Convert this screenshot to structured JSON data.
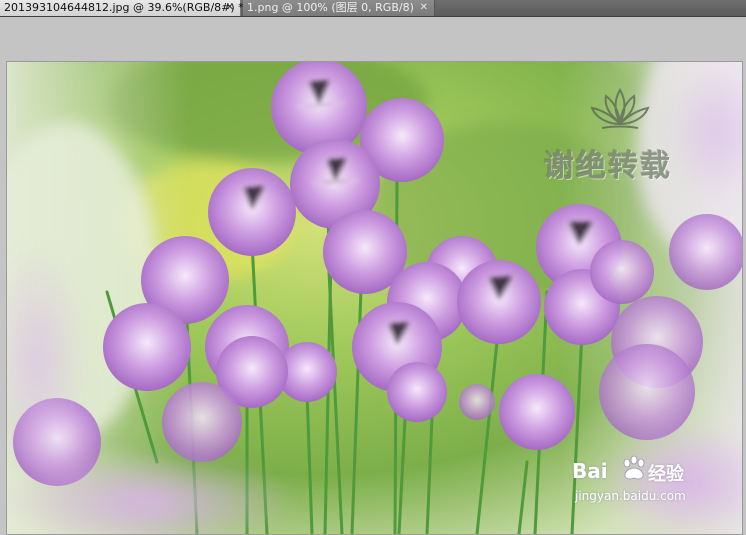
{
  "tabs": [
    {
      "label": "20139310464481​2.jpg @ 39.6%(RGB/8#) *",
      "close": "✕",
      "active": true
    },
    {
      "label": "1.png @ 100% (图层 0, RGB/8)",
      "close": "✕",
      "active": false
    }
  ],
  "canvas": {
    "watermark_text": "谢绝转载",
    "baidu_logo_text": "Bai",
    "baidu_logo_suffix": "经验",
    "baidu_url": "jingyan.baidu.com"
  },
  "icons": {
    "close": "close-icon",
    "lotus": "lotus-icon",
    "baidu_paw": "paw-icon"
  }
}
